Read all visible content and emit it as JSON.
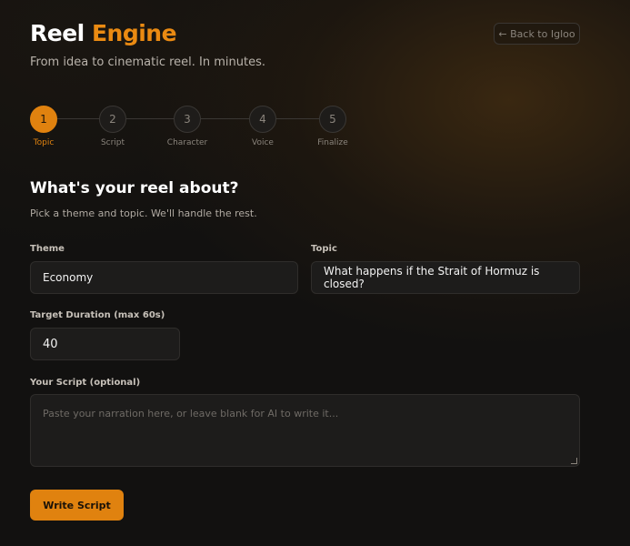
{
  "header": {
    "title_part1": "Reel",
    "title_part2": "Engine",
    "tagline": "From idea to cinematic reel. In minutes.",
    "back_label": "← Back to Igloo"
  },
  "stepper": {
    "steps": [
      {
        "number": "1",
        "label": "Topic",
        "active": true
      },
      {
        "number": "2",
        "label": "Script",
        "active": false
      },
      {
        "number": "3",
        "label": "Character",
        "active": false
      },
      {
        "number": "4",
        "label": "Voice",
        "active": false
      },
      {
        "number": "5",
        "label": "Finalize",
        "active": false
      }
    ]
  },
  "form": {
    "title": "What's your reel about?",
    "subtitle": "Pick a theme and topic. We'll handle the rest.",
    "theme_label": "Theme",
    "theme_value": "Economy",
    "topic_label": "Topic",
    "topic_value": "What happens if the Strait of Hormuz is closed?",
    "duration_label": "Target Duration (max 60s)",
    "duration_value": "40",
    "script_label": "Your Script (optional)",
    "script_placeholder": "Paste your narration here, or leave blank for AI to write it...",
    "submit_label": "Write Script"
  },
  "colors": {
    "accent": "#e0820f",
    "background": "#121110",
    "field_bg": "#1d1c1b"
  }
}
